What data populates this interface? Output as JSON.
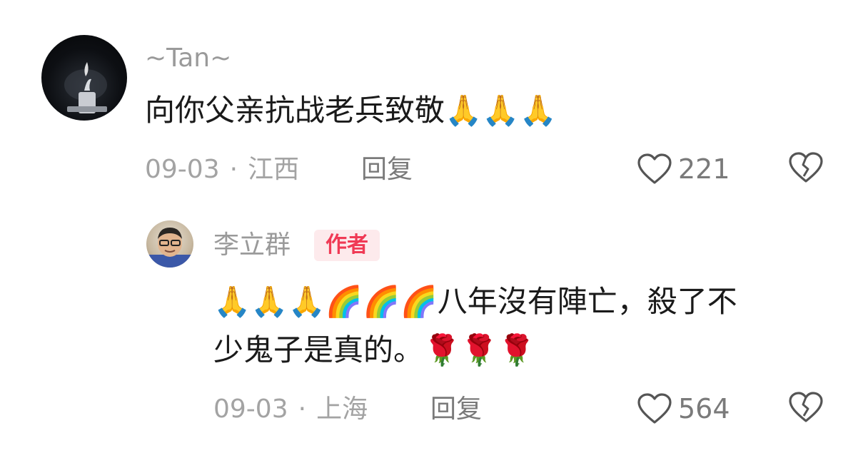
{
  "comment": {
    "username": "~Tan~",
    "text": "向你父亲抗战老兵致敬🙏🙏🙏",
    "date": "09-03",
    "separator": "·",
    "location": "江西",
    "reply_label": "回复",
    "likes": "221"
  },
  "reply": {
    "username": "李立群",
    "badge": "作者",
    "line1": "🙏🙏🙏🌈🌈🌈八年沒有陣亡，殺了不",
    "line2": "少鬼子是真的。🌹🌹🌹",
    "date": "09-03",
    "separator": "·",
    "location": "上海",
    "reply_label": "回复",
    "likes": "564"
  },
  "icons": {
    "like": "heart-outline-icon",
    "dislike": "broken-heart-icon",
    "avatar_main": "candle-dark-avatar",
    "avatar_reply": "man-glasses-avatar"
  },
  "colors": {
    "badge_bg": "#fdeaec",
    "badge_text": "#f03a55",
    "meta": "#a3a3a3",
    "text": "#1a1a1a"
  }
}
